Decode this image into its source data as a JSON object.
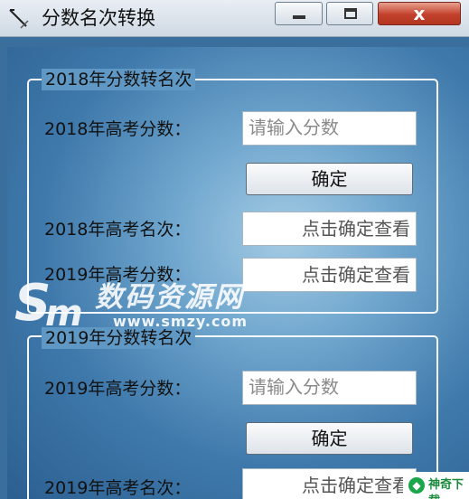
{
  "window": {
    "title": "分数名次转换",
    "min_glyph": "",
    "max_glyph": "",
    "close_glyph": "x",
    "colors": {
      "close_button": "#c2412c",
      "client_background": "#3f79ab"
    }
  },
  "group1": {
    "legend": "2018年分数转名次",
    "score_label": "2018年高考分数：",
    "score_placeholder": "请输入分数",
    "confirm_label": "确定",
    "rank_label": "2018年高考名次：",
    "rank_value": "点击确定查看",
    "score2019_label": "2019年高考分数：",
    "score2019_value": "点击确定查看"
  },
  "group2": {
    "legend": "2019年分数转名次",
    "score_label": "2019年高考分数：",
    "score_placeholder": "请输入分数",
    "confirm_label": "确定",
    "rank_label": "2019年高考名次：",
    "rank_value": "点击确定查看"
  },
  "watermark": {
    "name": "数码资源网",
    "url": "www.smzy.com",
    "badge": "神奇下载"
  }
}
